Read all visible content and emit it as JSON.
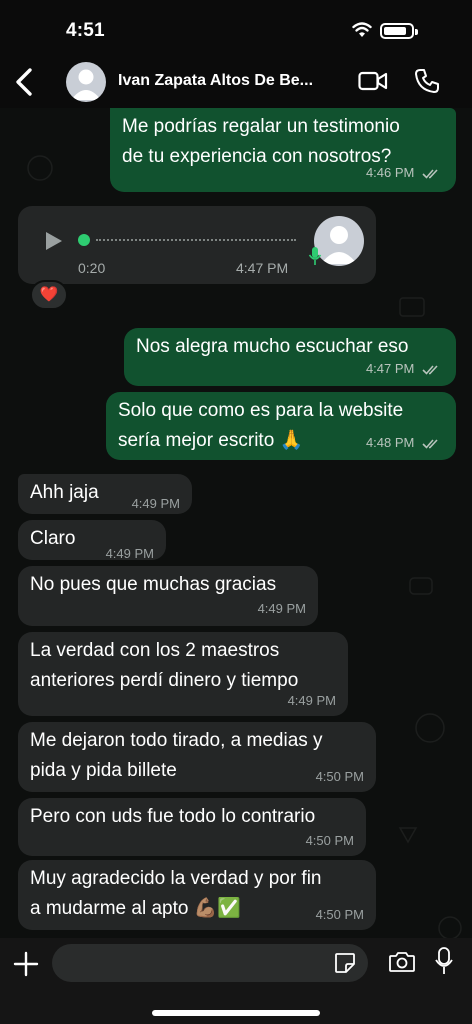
{
  "status_bar": {
    "time": "4:51"
  },
  "header": {
    "contact_name": "Ivan Zapata Altos De Be..."
  },
  "messages": [
    {
      "direction": "out",
      "lines": [
        "Me podrías regalar un testimonio",
        "de tu experiencia con nosotros?"
      ],
      "time": "4:46 PM",
      "read": true
    },
    {
      "direction": "in",
      "type": "voice",
      "duration": "0:20",
      "time": "4:47 PM",
      "reaction": "❤️"
    },
    {
      "direction": "out",
      "lines": [
        "Nos alegra mucho escuchar eso"
      ],
      "time": "4:47 PM",
      "read": true
    },
    {
      "direction": "out",
      "lines": [
        "Solo que como es para la website",
        "sería mejor escrito 🙏"
      ],
      "time": "4:48 PM",
      "read": true
    },
    {
      "direction": "in",
      "lines": [
        "Ahh jaja"
      ],
      "time": "4:49 PM"
    },
    {
      "direction": "in",
      "lines": [
        "Claro"
      ],
      "time": "4:49 PM"
    },
    {
      "direction": "in",
      "lines": [
        "No pues que muchas gracias"
      ],
      "time": "4:49 PM"
    },
    {
      "direction": "in",
      "lines": [
        "La verdad con los 2 maestros",
        "anteriores perdí dinero y tiempo"
      ],
      "time": "4:49 PM"
    },
    {
      "direction": "in",
      "lines": [
        "Me dejaron todo tirado, a medias y",
        "pida y pida billete"
      ],
      "time": "4:50 PM"
    },
    {
      "direction": "in",
      "lines": [
        "Pero con uds fue todo lo contrario"
      ],
      "time": "4:50 PM"
    },
    {
      "direction": "in",
      "lines": [
        "Muy agradecido la verdad y por fin",
        "a mudarme al apto 💪🏽✅"
      ],
      "time": "4:50 PM"
    }
  ],
  "input": {
    "value": "",
    "placeholder": ""
  },
  "colors": {
    "outgoing_bubble": "#11522f",
    "incoming_bubble": "#242626",
    "accent": "#2ecc71"
  }
}
